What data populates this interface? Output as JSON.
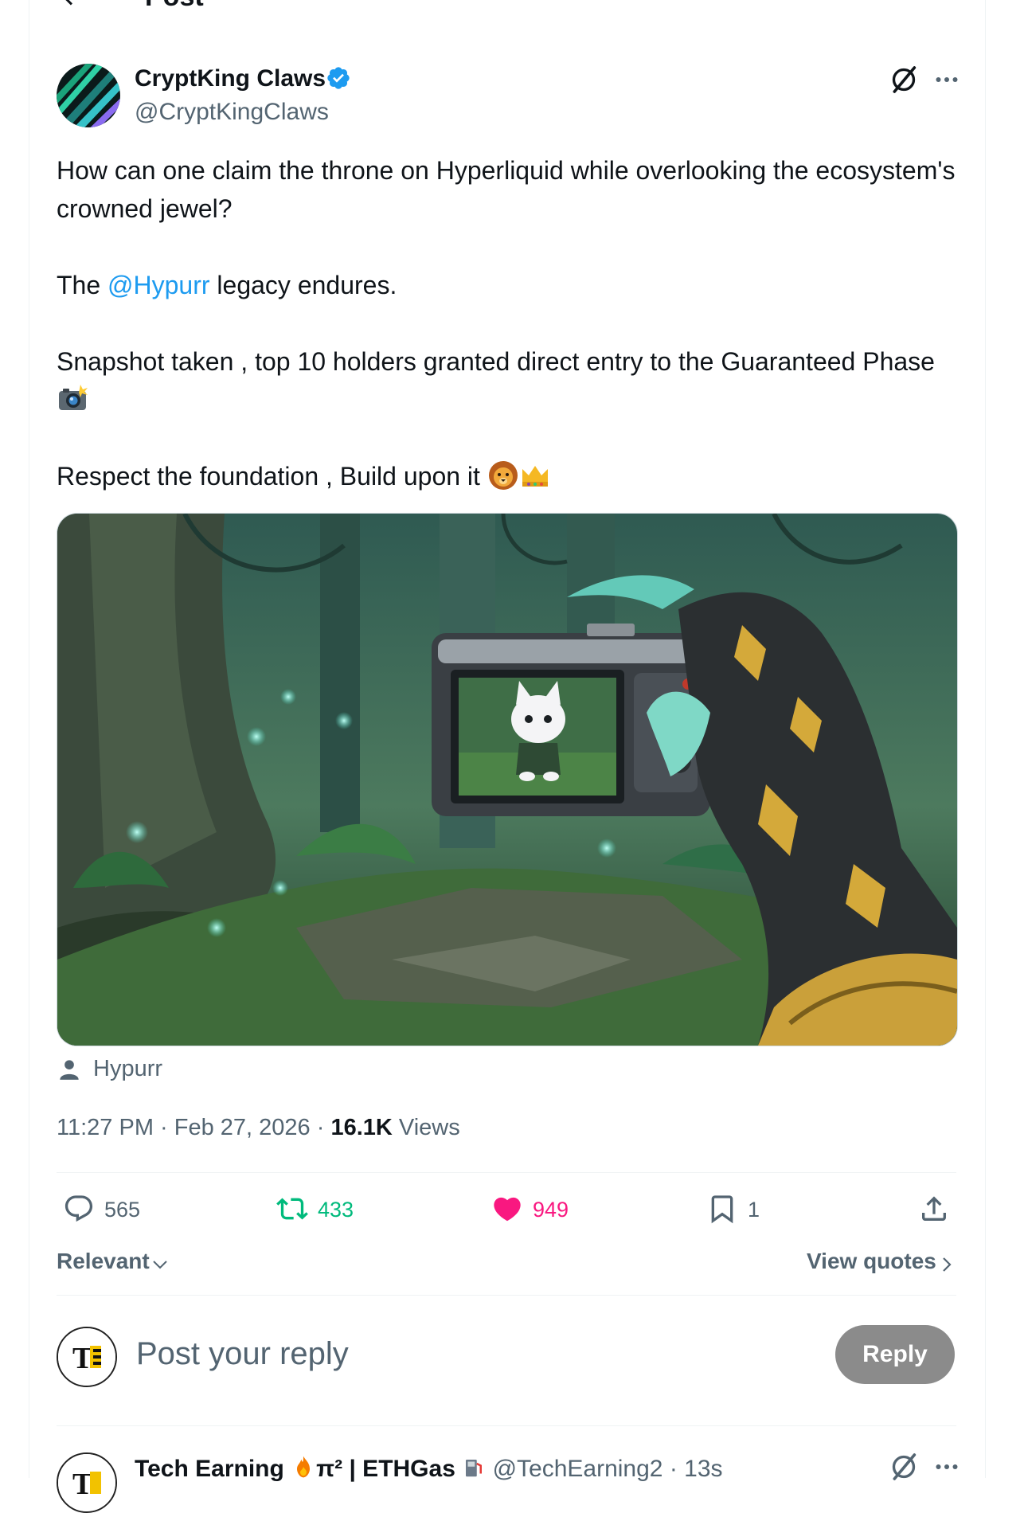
{
  "header": {
    "title": "Post",
    "back_icon": "arrow-left-icon"
  },
  "post": {
    "author": {
      "name": "CryptKing Claws",
      "handle": "@CryptKingClaws",
      "verified": true
    },
    "text": {
      "p1": "How can one claim the throne on Hyperliquid while overlooking the ecosystem's crowned jewel?",
      "p2_before": "The ",
      "p2_mention": "@Hypurr",
      "p2_after": " legacy endures.",
      "p3": "Snapshot taken , top 10 holders granted direct entry to the Guaranteed Phase",
      "p4": "Respect the foundation , Build upon it"
    },
    "tagged_user": "Hypurr",
    "time": "11:27 PM",
    "separator": " · ",
    "date": "Feb 27, 2026",
    "views_count": "16.1K",
    "views_label": " Views",
    "stats": {
      "replies": "565",
      "reposts": "433",
      "likes": "949",
      "bookmarks": "1"
    }
  },
  "filters": {
    "sort_label": "Relevant",
    "view_quotes_label": "View quotes"
  },
  "composer": {
    "placeholder": "Post your reply",
    "reply_button": "Reply"
  },
  "next_reply": {
    "name": "Tech Earning",
    "name_mid": "π² | ETHGas",
    "handle": "@TechEarning2",
    "time": "13s"
  },
  "colors": {
    "accent": "#1d9bf0",
    "repost_green": "#00ba7c",
    "like_pink": "#f91880",
    "muted_text": "#536471",
    "reply_button_bg": "#8b8b8b"
  }
}
